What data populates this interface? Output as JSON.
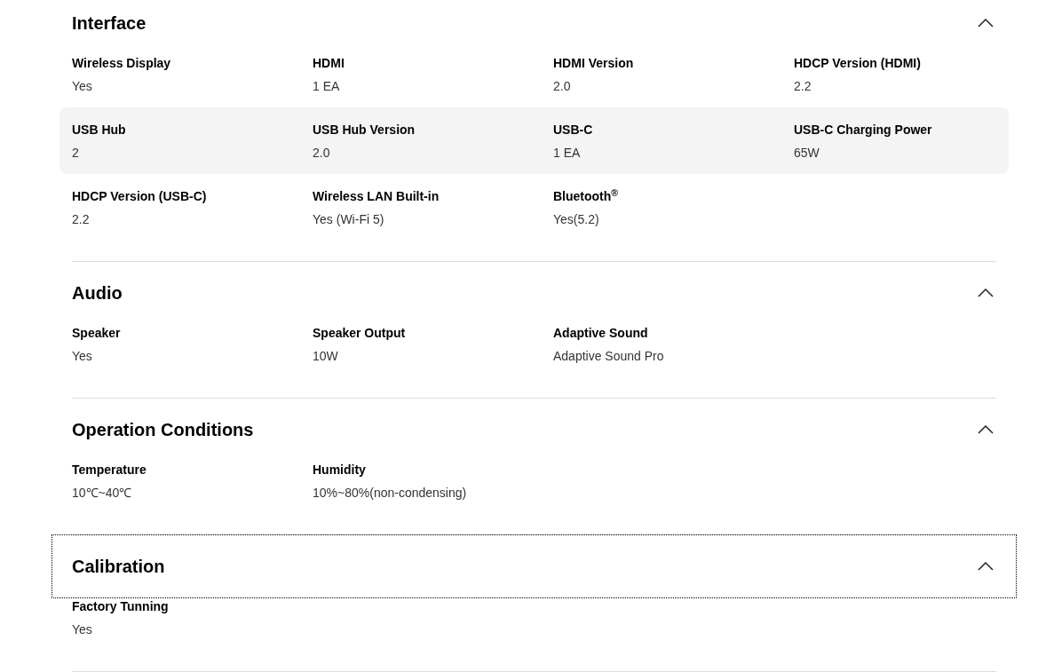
{
  "sections": [
    {
      "title": "Interface",
      "expanded": true,
      "focused": false,
      "rows": [
        {
          "highlighted": false,
          "specs": [
            {
              "label": "Wireless Display",
              "value": "Yes"
            },
            {
              "label": "HDMI",
              "value": "1 EA"
            },
            {
              "label": "HDMI Version",
              "value": "2.0"
            },
            {
              "label": "HDCP Version (HDMI)",
              "value": "2.2"
            }
          ]
        },
        {
          "highlighted": true,
          "specs": [
            {
              "label": "USB Hub",
              "value": "2"
            },
            {
              "label": "USB Hub Version",
              "value": "2.0"
            },
            {
              "label": "USB-C",
              "value": "1 EA"
            },
            {
              "label": "USB-C Charging Power",
              "value": "65W"
            }
          ]
        },
        {
          "highlighted": false,
          "specs": [
            {
              "label": "HDCP Version (USB-C)",
              "value": "2.2"
            },
            {
              "label": "Wireless LAN Built-in",
              "value": "Yes (Wi-Fi 5)"
            },
            {
              "label": "Bluetooth$^{®}$",
              "value": "Yes(5.2)"
            }
          ]
        }
      ]
    },
    {
      "title": "Audio",
      "expanded": true,
      "focused": false,
      "rows": [
        {
          "highlighted": false,
          "specs": [
            {
              "label": "Speaker",
              "value": "Yes"
            },
            {
              "label": "Speaker Output",
              "value": "10W"
            },
            {
              "label": "Adaptive Sound",
              "value": "Adaptive Sound Pro"
            }
          ]
        }
      ]
    },
    {
      "title": "Operation Conditions",
      "expanded": true,
      "focused": false,
      "rows": [
        {
          "highlighted": false,
          "specs": [
            {
              "label": "Temperature",
              "value": "10℃~40℃"
            },
            {
              "label": "Humidity",
              "value": "10%~80%(non-condensing)"
            }
          ]
        }
      ]
    },
    {
      "title": "Calibration",
      "expanded": true,
      "focused": true,
      "rows": [
        {
          "highlighted": false,
          "specs": [
            {
              "label": "Factory Tunning",
              "value": "Yes"
            }
          ]
        }
      ]
    }
  ]
}
